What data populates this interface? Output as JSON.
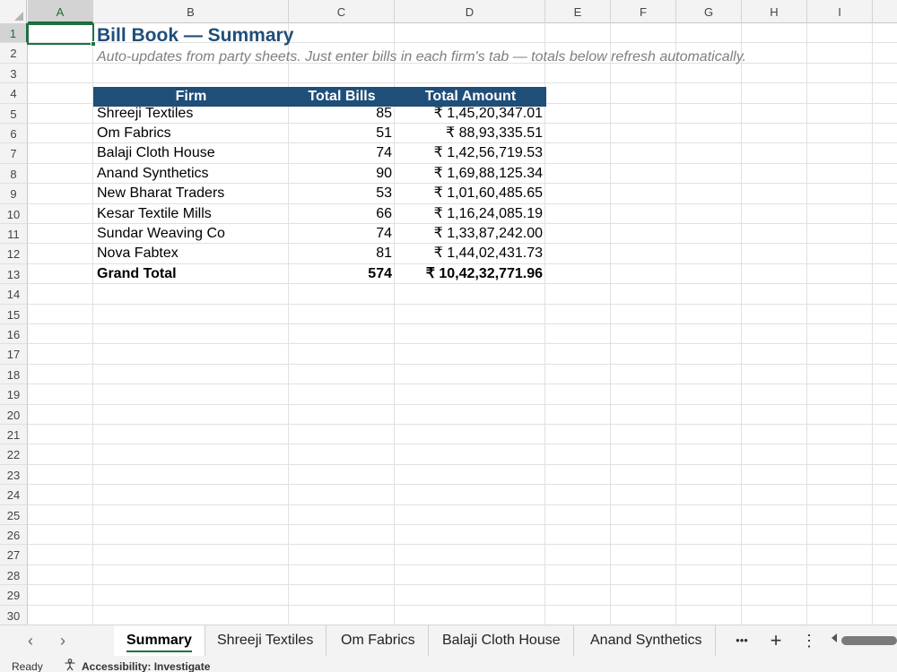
{
  "columns": [
    "A",
    "B",
    "C",
    "D",
    "E",
    "F",
    "G",
    "H",
    "I"
  ],
  "rows": [
    "1",
    "2",
    "3",
    "4",
    "5",
    "6",
    "7",
    "8",
    "9",
    "10",
    "11",
    "12",
    "13",
    "14",
    "15",
    "16",
    "17",
    "18",
    "19",
    "20",
    "21",
    "22",
    "23",
    "24",
    "25",
    "26",
    "27",
    "28",
    "29",
    "30"
  ],
  "sheet": {
    "title": "Bill Book — Summary",
    "subtitle": "Auto-updates from party sheets. Just enter bills in each firm's tab — totals below refresh automatically.",
    "table": {
      "headers": {
        "firm": "Firm",
        "bills": "Total Bills",
        "amount": "Total Amount"
      },
      "rows": [
        {
          "firm": "Shreeji Textiles",
          "bills": "85",
          "amount": "₹ 1,45,20,347.01"
        },
        {
          "firm": "Om Fabrics",
          "bills": "51",
          "amount": "₹ 88,93,335.51"
        },
        {
          "firm": "Balaji Cloth House",
          "bills": "74",
          "amount": "₹ 1,42,56,719.53"
        },
        {
          "firm": "Anand Synthetics",
          "bills": "90",
          "amount": "₹ 1,69,88,125.34"
        },
        {
          "firm": "New Bharat Traders",
          "bills": "53",
          "amount": "₹ 1,01,60,485.65"
        },
        {
          "firm": "Kesar Textile Mills",
          "bills": "66",
          "amount": "₹ 1,16,24,085.19"
        },
        {
          "firm": "Sundar Weaving Co",
          "bills": "74",
          "amount": "₹ 1,33,87,242.00"
        },
        {
          "firm": "Nova Fabtex",
          "bills": "81",
          "amount": "₹ 1,44,02,431.73"
        }
      ],
      "total": {
        "label": "Grand Total",
        "bills": "574",
        "amount": "₹ 10,42,32,771.96"
      }
    },
    "header_color": "#1f4e79"
  },
  "tabs": {
    "prev_icon": "chevron-left-icon",
    "next_icon": "chevron-right-icon",
    "items": [
      "Summary",
      "Shreeji Textiles",
      "Om Fabrics",
      "Balaji Cloth House",
      "Anand Synthetics"
    ],
    "active": "Summary",
    "more": "•••",
    "add": "+",
    "options": "⋮"
  },
  "status": {
    "ready": "Ready",
    "accessibility": "Accessibility: Investigate"
  },
  "accent_color": "#1e7145"
}
